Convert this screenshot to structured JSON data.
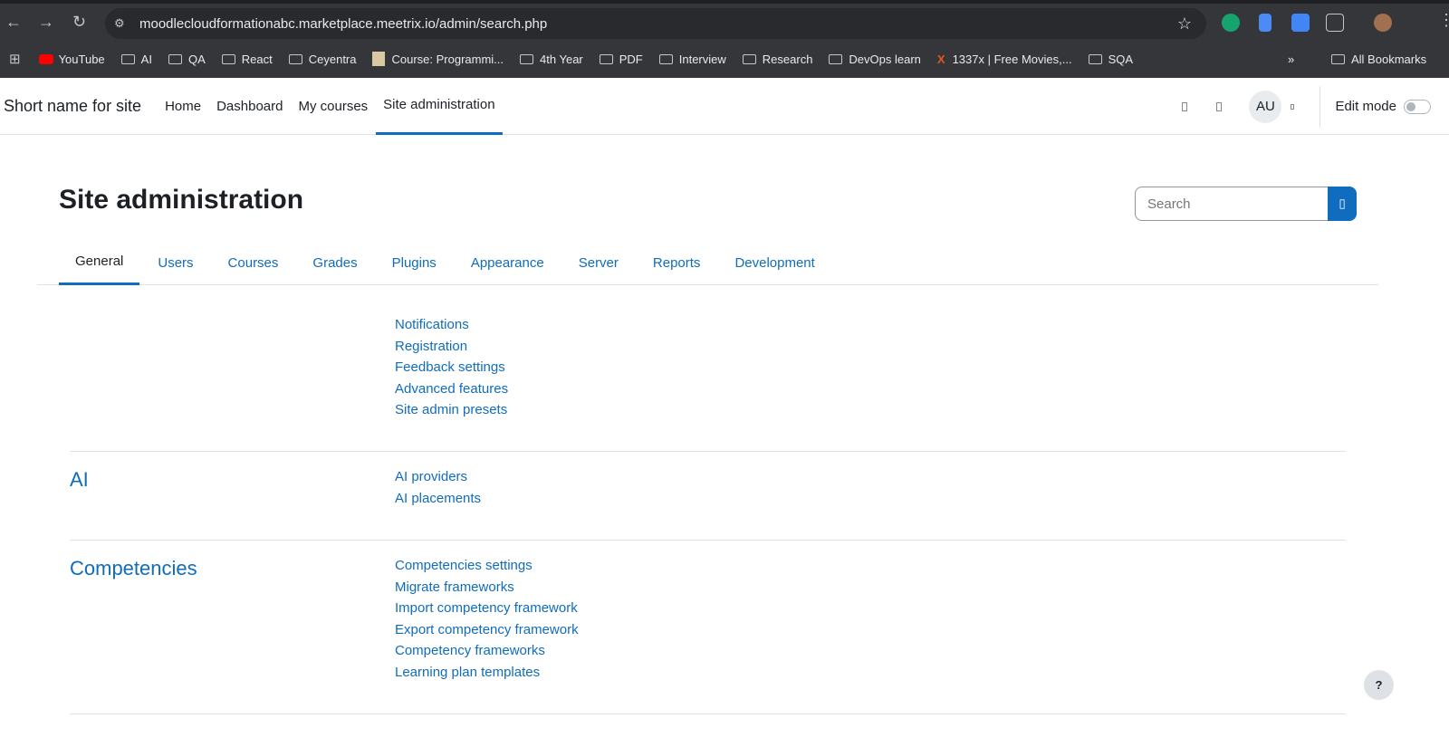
{
  "browser": {
    "url": "moodlecloudformationabc.marketplace.meetrix.io/admin/search.php",
    "bookmarks": [
      "YouTube",
      "AI",
      "QA",
      "React",
      "Ceyentra",
      "Course: Programmi...",
      "4th Year",
      "PDF",
      "Interview",
      "Research",
      "DevOps learn",
      "1337x | Free Movies,...",
      "SQA"
    ],
    "all_bookmarks": "All Bookmarks"
  },
  "nav": {
    "brand": "Short name for site",
    "links": [
      "Home",
      "Dashboard",
      "My courses",
      "Site administration"
    ],
    "avatar": "AU",
    "edit_mode": "Edit mode"
  },
  "page": {
    "title": "Site administration",
    "search_placeholder": "Search",
    "tabs": [
      "General",
      "Users",
      "Courses",
      "Grades",
      "Plugins",
      "Appearance",
      "Server",
      "Reports",
      "Development"
    ],
    "general_links": [
      "Notifications",
      "Registration",
      "Feedback settings",
      "Advanced features",
      "Site admin presets"
    ],
    "ai": {
      "heading": "AI",
      "links": [
        "AI providers",
        "AI placements"
      ]
    },
    "competencies": {
      "heading": "Competencies",
      "links": [
        "Competencies settings",
        "Migrate frameworks",
        "Import competency framework",
        "Export competency framework",
        "Competency frameworks",
        "Learning plan templates"
      ]
    }
  },
  "help": "?"
}
